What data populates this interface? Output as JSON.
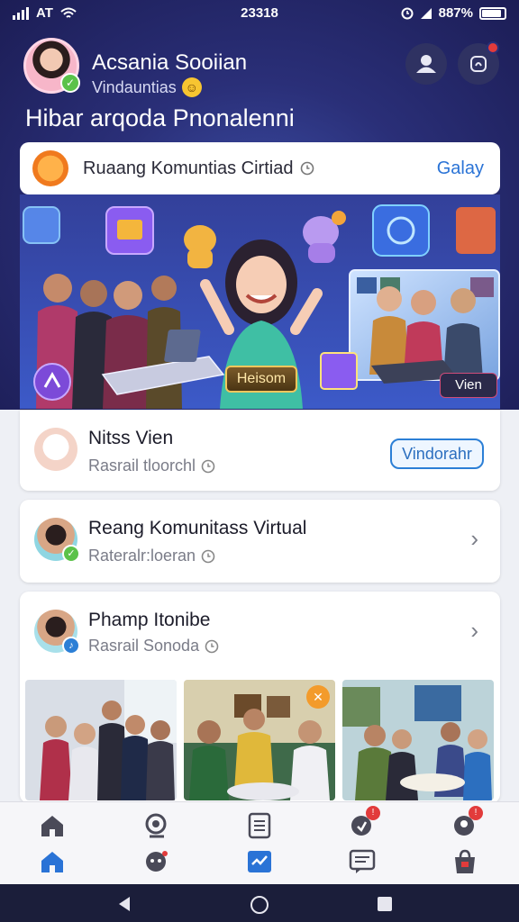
{
  "status_bar": {
    "carrier": "AT",
    "time": "23318",
    "battery": "887%"
  },
  "profile": {
    "name": "Acsania Sooiian",
    "subtitle": "Vindauntias",
    "greeting": "Hibar arqoda Pnonalenni"
  },
  "community_card": {
    "title": "Ruaang Komuntias Cirtiad",
    "action": "Galay"
  },
  "hero": {
    "center_label": "Heisom",
    "corner_label": "Vien"
  },
  "list": [
    {
      "title": "Nitss Vien",
      "subtitle": "Rasrail tloorchl",
      "action": "Vindorahr"
    },
    {
      "title": "Reang Komunitass Virtual",
      "subtitle": "Rateralr:loeran"
    },
    {
      "title": "Phamp Itonibe",
      "subtitle": "Rasrail Sonoda"
    }
  ],
  "nav": {
    "top_row_icons": [
      "home-outline-icon",
      "community-icon",
      "document-icon",
      "notification-icon",
      "profile-alert-icon"
    ],
    "bottom_row_icons": [
      "home-icon",
      "chat-icon",
      "tasks-icon",
      "messages-icon",
      "shop-icon"
    ],
    "badge_counts": [
      "!",
      "!"
    ]
  },
  "colors": {
    "header_bg": "#2a2f78",
    "accent_blue": "#2a73d6",
    "alert_red": "#e23b3b",
    "card_bg": "#ffffff"
  }
}
